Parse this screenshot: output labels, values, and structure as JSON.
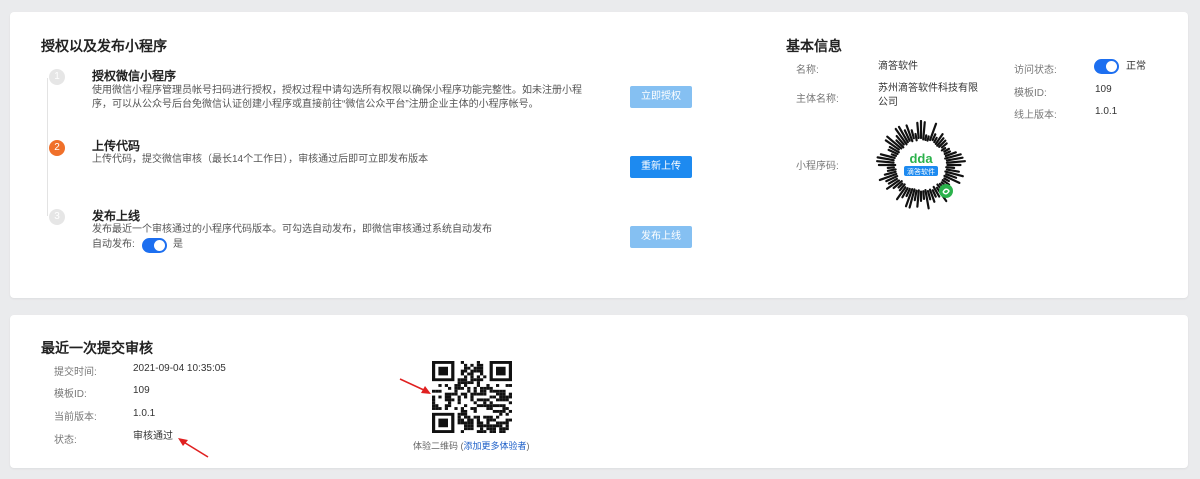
{
  "auth_section": {
    "title": "授权以及发布小程序",
    "steps": [
      {
        "number": "1",
        "title": "授权微信小程序",
        "desc_line1": "使用微信小程序管理员帐号扫码进行授权，授权过程中请勾选所有权限以确保小程序功能完整性。如未注册小程",
        "desc_line2": "序，可以从公众号后台免微信认证创建小程序或直接前往“微信公众平台”注册企业主体的小程序帐号。",
        "button": "立即授权"
      },
      {
        "number": "2",
        "title": "上传代码",
        "desc_line1": "上传代码，提交微信审核（最长14个工作日），审核通过后即可立即发布版本",
        "button": "重新上传"
      },
      {
        "number": "3",
        "title": "发布上线",
        "desc_line1": "发布最近一个审核通过的小程序代码版本。可勾选自动发布，即微信审核通过系统自动发布",
        "auto_publish_label": "自动发布:",
        "auto_publish_value": "是",
        "button": "发布上线"
      }
    ]
  },
  "basic_info": {
    "title": "基本信息",
    "name_label": "名称:",
    "name_value": "滴答软件",
    "entity_label": "主体名称:",
    "entity_value_line1": "苏州滴答软件科技有限",
    "entity_value_line2": "公司",
    "mini_code_label": "小程序码:",
    "mini_code_text": "滴答软件",
    "mini_code_logo": "dda",
    "access_label": "访问状态:",
    "access_value": "正常",
    "template_label": "模板ID:",
    "template_value": "109",
    "online_version_label": "线上版本:",
    "online_version_value": "1.0.1"
  },
  "review": {
    "title": "最近一次提交审核",
    "submit_time_label": "提交时间:",
    "submit_time_value": "2021-09-04 10:35:05",
    "template_label": "模板ID:",
    "template_value": "109",
    "version_label": "当前版本:",
    "version_value": "1.0.1",
    "status_label": "状态:",
    "status_value": "审核通过",
    "qr_caption_prefix": "体验二维码 (",
    "qr_caption_link": "添加更多体验者",
    "qr_caption_suffix": ")"
  },
  "colors": {
    "primary": "#1d8af0",
    "primary_light": "#85c0f2",
    "step_active": "#f0702a",
    "switch": "#1d6ff0",
    "wechat_green": "#2bb24c",
    "annotation_arrow": "#e02020"
  }
}
